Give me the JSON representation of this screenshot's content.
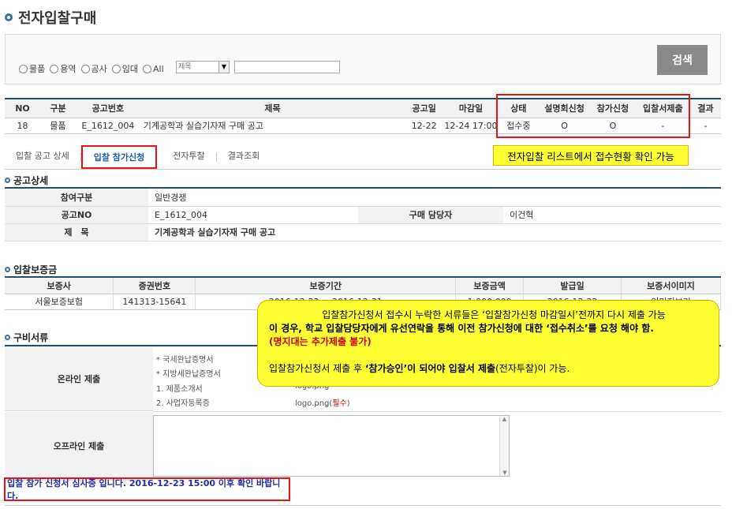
{
  "title": "전자입찰구매",
  "search": {
    "radios": [
      "물품",
      "용역",
      "공사",
      "임대",
      "All"
    ],
    "field_select": "제목",
    "search_value": "",
    "button": "검색"
  },
  "list": {
    "headers": [
      "NO",
      "구분",
      "공고번호",
      "제목",
      "공고일",
      "마감일",
      "상태",
      "설명회신청",
      "참가신청",
      "입찰서제출",
      "결과"
    ],
    "rows": [
      [
        "18",
        "물품",
        "E_1612_004",
        "기계공학과 실습기자재 구매 공고",
        "12-22",
        "12-24 17:00",
        "접수중",
        "O",
        "O",
        "-",
        "-"
      ]
    ]
  },
  "tabs": [
    "입찰 공고 상세",
    "입찰 참가신청",
    "전자투찰",
    "결과조회"
  ],
  "callouts": {
    "status": "전자입찰 리스트에서 접수현황 확인 가능",
    "main_line1": "입찰참가신청서 접수시 누락한 서류들은 ‘입찰참가신청 마감일시’전까지 다시 제출 가능",
    "main_line2": "이 경우, 학교 입찰담당자에게 유선연락을 통해 이전 참가신청에 대한 ‘접수취소’를 요청 해야 함.",
    "main_line3": "(명지대는 추가제출 불가)",
    "main_line4_pre": "입찰참가신청서 제출 후 ",
    "main_line4_bold": "‘참가승인’이 되어야 입찰서 제출",
    "main_line4_post": "(전자투찰)이 가능."
  },
  "detail": {
    "title": "공고상세",
    "participation_label": "참여구분",
    "participation_value": "일반경쟁",
    "notice_no_label": "공고NO",
    "notice_no_value": "E_1612_004",
    "manager_label": "구매 담당자",
    "manager_value": "이건혁",
    "subject_label": "제　목",
    "subject_value": "기계공학과 실습기자재 구매 공고"
  },
  "bond": {
    "title": "입찰보증금",
    "headers": [
      "보증사",
      "증권번호",
      "보증기간",
      "보증금액",
      "발급일",
      "보증서이미지"
    ],
    "row": [
      "서울보증보험",
      "141313-15641",
      "2016-12-22 ~ 2016-12-31",
      "1,000,000",
      "2016-12-22",
      "이미지보기"
    ]
  },
  "docs": {
    "title": "구비서류",
    "online_label": "온라인 제출",
    "online_items": [
      "* 국세완납증명서",
      "* 지방세완납증명서",
      "1. 제품소개서",
      "2. 사업자등록증"
    ],
    "files": [
      "logo.png",
      "logo.png"
    ],
    "required": "필수",
    "offline_label": "오프라인 제출"
  },
  "notice": "입찰 참가 신청서 심사중 입니다. 2016-12-23 15:00 이후 확인 바랍니다."
}
